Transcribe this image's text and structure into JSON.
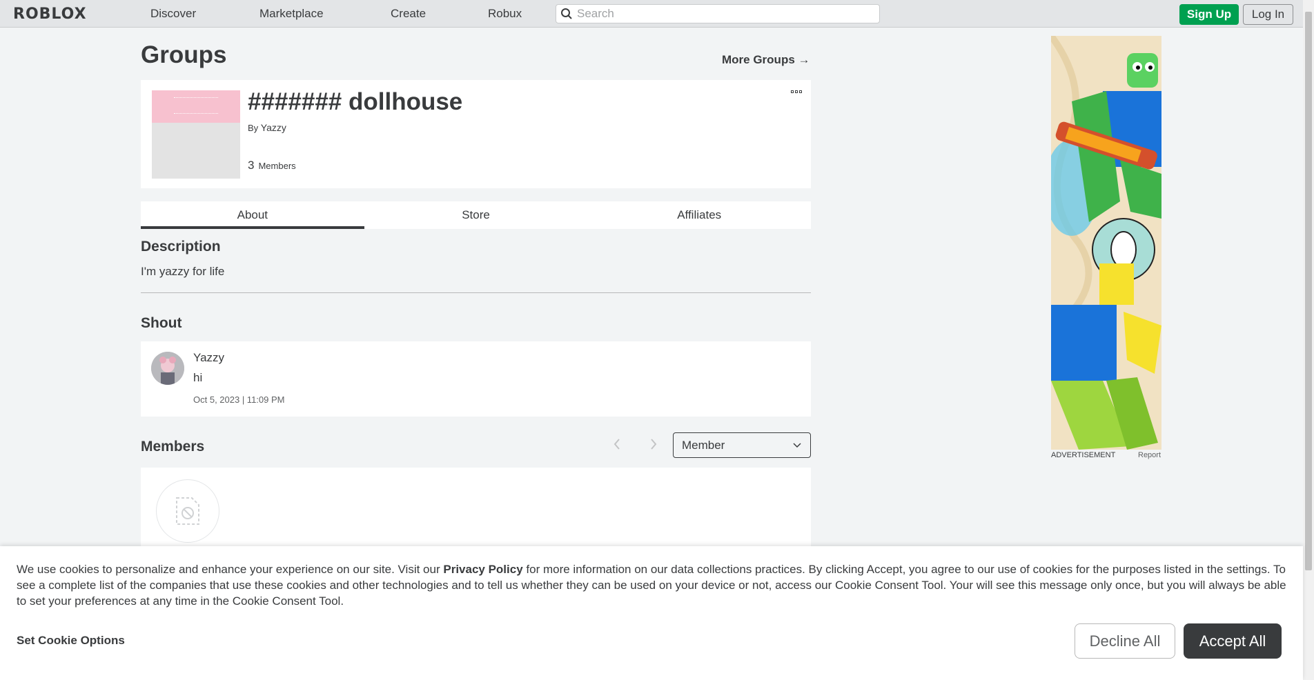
{
  "nav": {
    "logo": "ROBLOX",
    "links": [
      "Discover",
      "Marketplace",
      "Create",
      "Robux"
    ],
    "search_placeholder": "Search",
    "signup_label": "Sign Up",
    "login_label": "Log In"
  },
  "page": {
    "title": "Groups",
    "more_groups": "More Groups →"
  },
  "group": {
    "name": "####### dollhouse",
    "by_prefix": "By",
    "owner": "Yazzy",
    "member_count": "3",
    "members_label": "Members"
  },
  "tabs": [
    "About",
    "Store",
    "Affiliates"
  ],
  "description": {
    "heading": "Description",
    "text": "I'm yazzy for life"
  },
  "shout": {
    "heading": "Shout",
    "user": "Yazzy",
    "body": "hi",
    "date": "Oct 5, 2023 | 11:09 PM"
  },
  "members": {
    "heading": "Members",
    "role_selected": "Member"
  },
  "ad": {
    "label": "ADVERTISEMENT",
    "report": "Report"
  },
  "cookie": {
    "text_before": "We use cookies to personalize and enhance your experience on our site. Visit our ",
    "privacy_link": "Privacy Policy",
    "text_after": " for more information on our data collections practices. By clicking Accept, you agree to our use of cookies for the purposes listed in the settings. To see a complete list of the companies that use these cookies and other technologies and to tell us whether they can be used on your device or not, access our Cookie Consent Tool. Your will see this message only once, but you will always be able to set your preferences at any time in the Cookie Consent Tool.",
    "options_label": "Set Cookie Options",
    "decline_label": "Decline All",
    "accept_label": "Accept All"
  },
  "colors": {
    "signup_green": "#00a050",
    "accept_dark": "#393b3d",
    "background": "#f2f4f5"
  }
}
